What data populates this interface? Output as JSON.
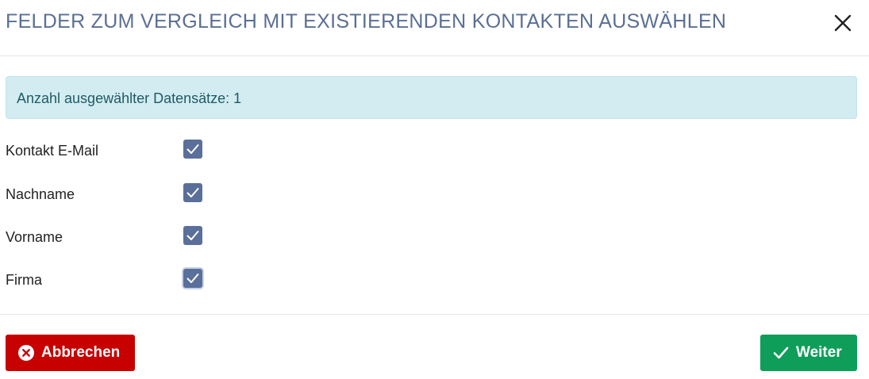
{
  "dialog": {
    "title": "FELDER ZUM VERGLEICH MIT EXISTIERENDEN KONTAKTEN AUSWÄHLEN",
    "close_icon": "close-icon"
  },
  "info": {
    "text": "Anzahl ausgewählter Datensätze: 1"
  },
  "fields": [
    {
      "label": "Kontakt E-Mail",
      "checked": true
    },
    {
      "label": "Nachname",
      "checked": true
    },
    {
      "label": "Vorname",
      "checked": true
    },
    {
      "label": "Firma",
      "checked": true
    }
  ],
  "footer": {
    "cancel_label": "Abbrechen",
    "cancel_icon": "circle-x-icon",
    "next_label": "Weiter",
    "next_icon": "checkmark-icon"
  },
  "colors": {
    "title": "#5a6f94",
    "checkbox": "#5a6f9a",
    "info_bg": "#d3ecf1",
    "cancel": "#c70000",
    "next": "#0f9d5a"
  }
}
